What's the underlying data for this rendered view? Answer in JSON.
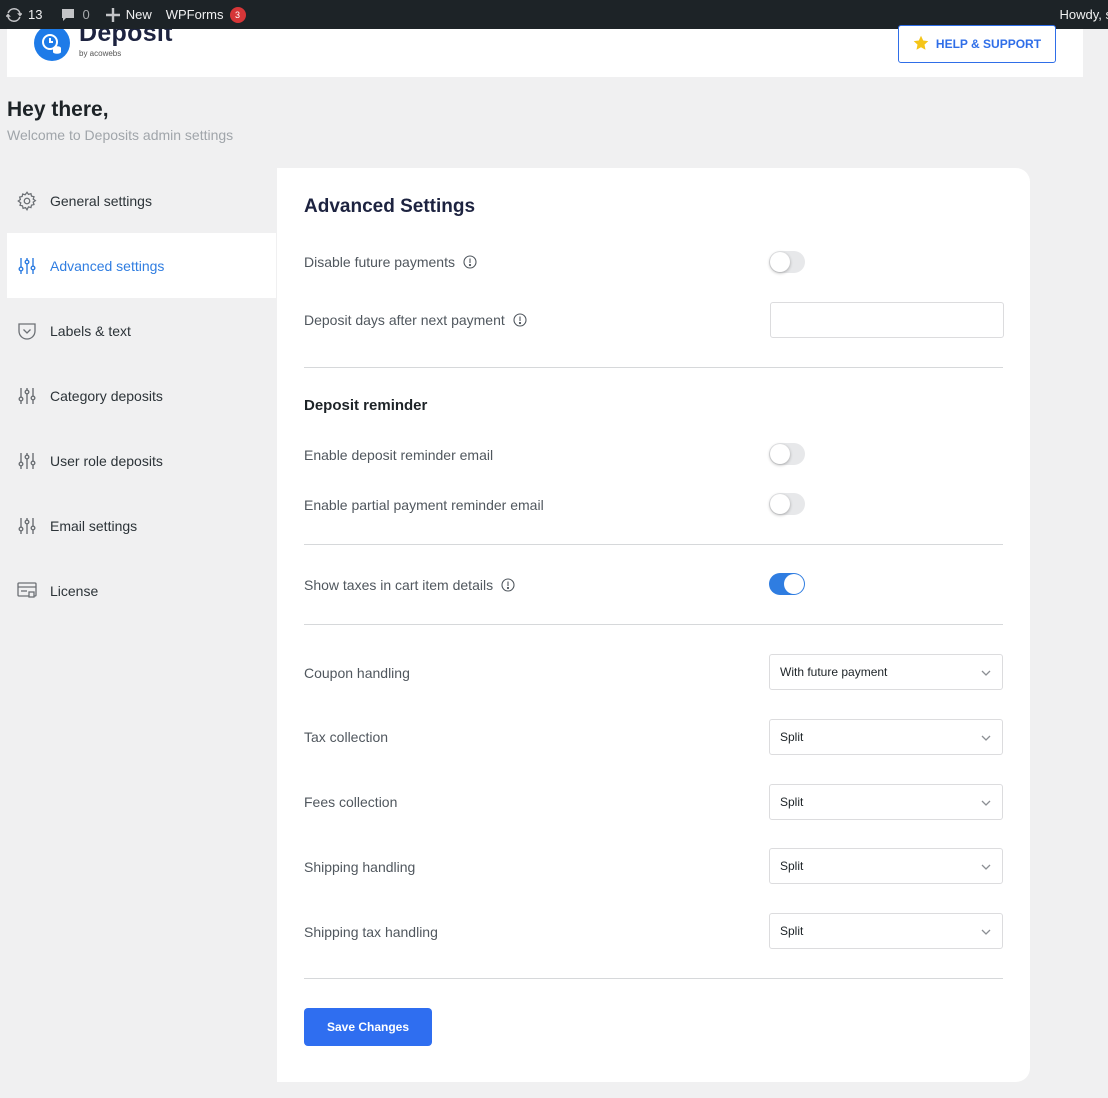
{
  "adminbar": {
    "updates_count": "13",
    "comments_count": "0",
    "new_label": "New",
    "wpforms_label": "WPForms",
    "wpforms_badge": "3",
    "howdy_text": "Howdy, s"
  },
  "header": {
    "logo_title": "Deposit",
    "logo_subtitle": "by acowebs",
    "help_button": "HELP & SUPPORT",
    "help_icon": "star-icon"
  },
  "greeting": {
    "title": "Hey there,",
    "subtitle": "Welcome to Deposits admin settings"
  },
  "sidebar": {
    "items": [
      {
        "label": "General settings",
        "icon": "gear-icon",
        "active": false
      },
      {
        "label": "Advanced settings",
        "icon": "sliders-icon",
        "active": true
      },
      {
        "label": "Labels & text",
        "icon": "label-icon",
        "active": false
      },
      {
        "label": "Category deposits",
        "icon": "sliders-icon",
        "active": false
      },
      {
        "label": "User role deposits",
        "icon": "sliders-icon",
        "active": false
      },
      {
        "label": "Email settings",
        "icon": "sliders-icon",
        "active": false
      },
      {
        "label": "License",
        "icon": "license-icon",
        "active": false
      }
    ]
  },
  "settings": {
    "title": "Advanced Settings",
    "disable_future_payments": {
      "label": "Disable future payments",
      "enabled": false
    },
    "deposit_days": {
      "label": "Deposit days after next payment",
      "value": ""
    },
    "reminder_section_title": "Deposit reminder",
    "deposit_reminder_email": {
      "label": "Enable deposit reminder email",
      "enabled": false
    },
    "partial_reminder_email": {
      "label": "Enable partial payment reminder email",
      "enabled": false
    },
    "show_taxes": {
      "label": "Show taxes in cart item details",
      "enabled": true
    },
    "coupon_handling": {
      "label": "Coupon handling",
      "value": "With future payment"
    },
    "tax_collection": {
      "label": "Tax collection",
      "value": "Split"
    },
    "fees_collection": {
      "label": "Fees collection",
      "value": "Split"
    },
    "shipping_handling": {
      "label": "Shipping handling",
      "value": "Split"
    },
    "shipping_tax_handling": {
      "label": "Shipping tax handling",
      "value": "Split"
    },
    "save_button": "Save Changes"
  },
  "colors": {
    "accent": "#2f7de1",
    "button": "#2f6ef0",
    "adminbar": "#1d2327",
    "badge": "#d63638"
  }
}
